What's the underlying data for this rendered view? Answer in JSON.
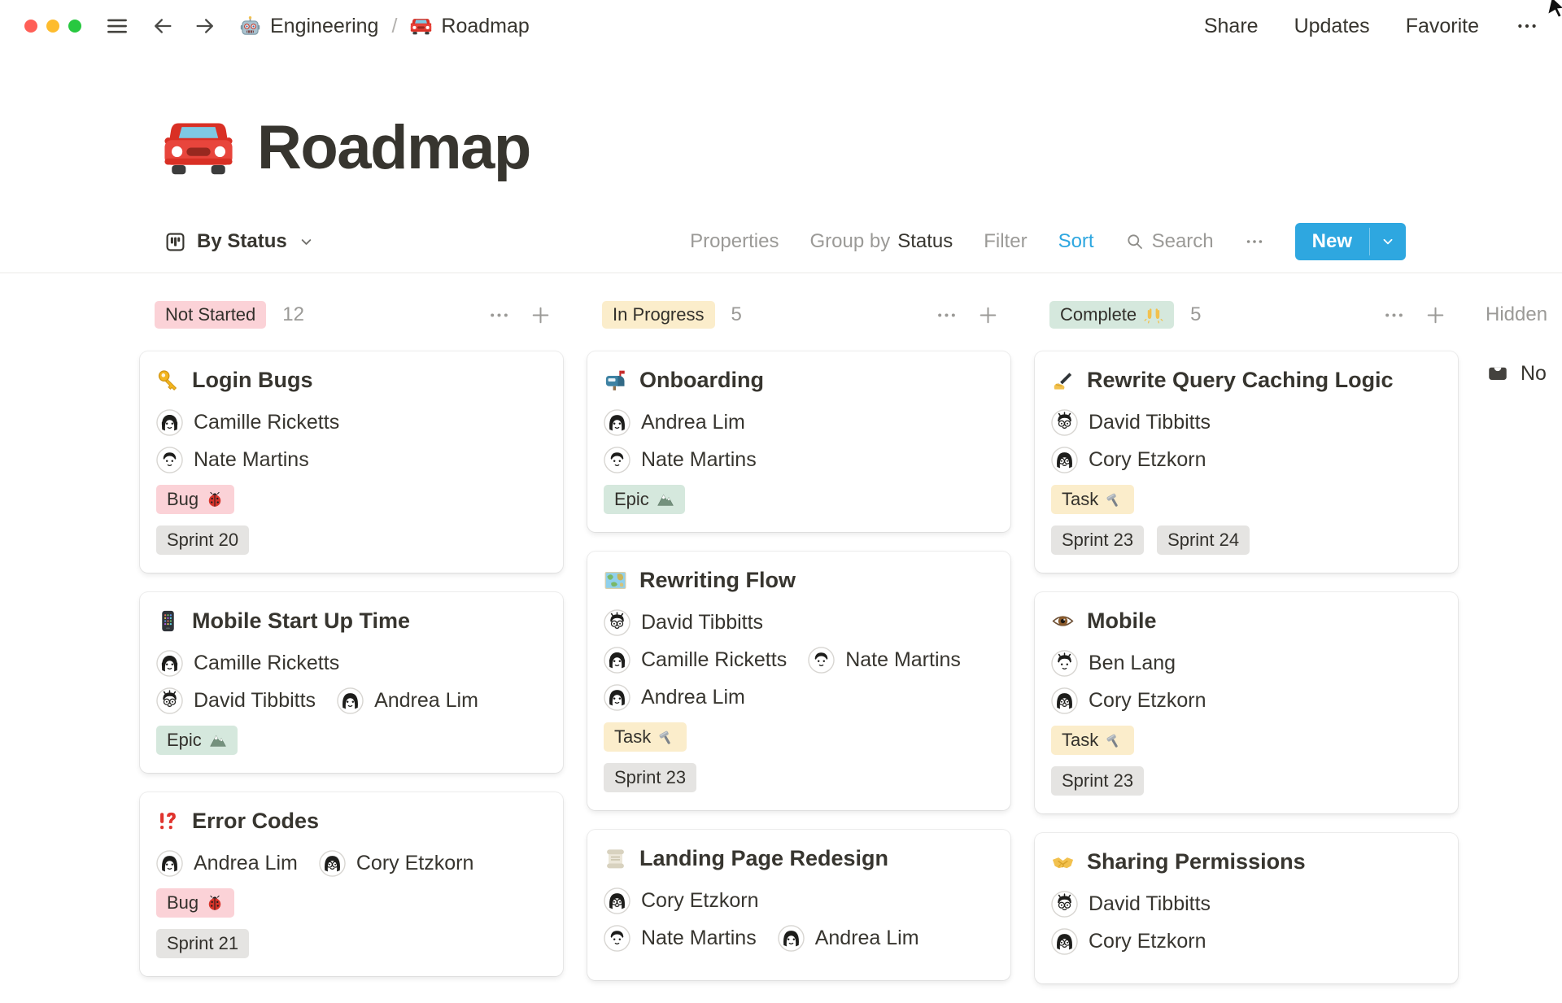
{
  "window": {
    "breadcrumb": [
      {
        "icon": "robot-icon",
        "label": "Engineering"
      },
      {
        "icon": "car-icon",
        "label": "Roadmap"
      }
    ],
    "breadcrumb_separator": "/",
    "actions": [
      "Share",
      "Updates",
      "Favorite"
    ]
  },
  "page": {
    "icon": "car-icon",
    "title": "Roadmap"
  },
  "toolbar": {
    "view_icon": "board-icon",
    "view_label": "By Status",
    "properties_label": "Properties",
    "group_by_prefix": "Group by",
    "group_by_value": "Status",
    "filter_label": "Filter",
    "sort_label": "Sort",
    "search_label": "Search",
    "new_label": "New"
  },
  "people": {
    "camille": {
      "name": "Camille Ricketts",
      "avatar": "woman-headphones"
    },
    "nate": {
      "name": "Nate Martins",
      "avatar": "man"
    },
    "david": {
      "name": "David Tibbitts",
      "avatar": "man-glasses"
    },
    "andrea": {
      "name": "Andrea Lim",
      "avatar": "woman-bob"
    },
    "cory": {
      "name": "Cory Etzkorn",
      "avatar": "woman-glasses"
    },
    "ben": {
      "name": "Ben Lang",
      "avatar": "man-dark"
    }
  },
  "board": {
    "columns": [
      {
        "name": "Not Started",
        "count": "12",
        "color": "pink",
        "cards": [
          {
            "icon": "key-icon",
            "title": "Login Bugs",
            "people": [
              [
                "camille"
              ],
              [
                "nate"
              ]
            ],
            "tags": [
              [
                {
                  "label": "Bug",
                  "icon": "ladybug-icon",
                  "color": "pink"
                }
              ],
              [
                {
                  "label": "Sprint 20",
                  "color": "gray"
                }
              ]
            ]
          },
          {
            "icon": "phone-icon",
            "title": "Mobile Start Up Time",
            "people": [
              [
                "camille"
              ],
              [
                "david",
                "andrea"
              ]
            ],
            "tags": [
              [
                {
                  "label": "Epic",
                  "icon": "mountain-icon",
                  "color": "green"
                }
              ]
            ]
          },
          {
            "icon": "bangbang-icon",
            "title": "Error Codes",
            "people": [
              [
                "andrea",
                "cory"
              ]
            ],
            "tags": [
              [
                {
                  "label": "Bug",
                  "icon": "ladybug-icon",
                  "color": "pink"
                }
              ],
              [
                {
                  "label": "Sprint 21",
                  "color": "gray"
                }
              ]
            ]
          }
        ]
      },
      {
        "name": "In Progress",
        "count": "5",
        "color": "yellow",
        "cards": [
          {
            "icon": "mailbox-icon",
            "title": "Onboarding",
            "people": [
              [
                "andrea"
              ],
              [
                "nate"
              ]
            ],
            "tags": [
              [
                {
                  "label": "Epic",
                  "icon": "mountain-icon",
                  "color": "green"
                }
              ]
            ]
          },
          {
            "icon": "map-icon",
            "title": "Rewriting Flow",
            "people": [
              [
                "david"
              ],
              [
                "camille",
                "nate"
              ],
              [
                "andrea"
              ]
            ],
            "tags": [
              [
                {
                  "label": "Task",
                  "icon": "hammer-icon",
                  "color": "yellow"
                }
              ],
              [
                {
                  "label": "Sprint 23",
                  "color": "gray"
                }
              ]
            ]
          },
          {
            "icon": "scroll-icon",
            "title": "Landing Page Redesign",
            "people": [
              [
                "cory"
              ],
              [
                "nate",
                "andrea"
              ]
            ],
            "tags": []
          }
        ]
      },
      {
        "name": "Complete",
        "icon": "raised-hands-icon",
        "count": "5",
        "color": "green",
        "cards": [
          {
            "icon": "writing-hand-icon",
            "title": "Rewrite Query Caching Logic",
            "people": [
              [
                "david"
              ],
              [
                "cory"
              ]
            ],
            "tags": [
              [
                {
                  "label": "Task",
                  "icon": "hammer-icon",
                  "color": "yellow"
                }
              ],
              [
                {
                  "label": "Sprint 23",
                  "color": "gray"
                },
                {
                  "label": "Sprint 24",
                  "color": "gray"
                }
              ]
            ]
          },
          {
            "icon": "eye-icon",
            "title": "Mobile",
            "people": [
              [
                "ben"
              ],
              [
                "cory"
              ]
            ],
            "tags": [
              [
                {
                  "label": "Task",
                  "icon": "hammer-icon",
                  "color": "yellow"
                }
              ],
              [
                {
                  "label": "Sprint 23",
                  "color": "gray"
                }
              ]
            ]
          },
          {
            "icon": "handshake-icon",
            "title": "Sharing Permissions",
            "people": [
              [
                "david"
              ],
              [
                "cory"
              ]
            ],
            "tags": []
          }
        ]
      }
    ],
    "hidden": {
      "label": "Hidden",
      "item_icon": "inbox-icon",
      "item_label": "No"
    }
  },
  "colors": {
    "accent_blue": "#2EA7E0",
    "text": "#37352F",
    "muted": "#9B9A97",
    "tags": {
      "pink": "#FBD2D7",
      "yellow": "#FBEDCB",
      "green": "#D5E8DD",
      "gray": "#E5E4E2"
    }
  },
  "icons": {
    "robot-icon": "🤖",
    "car-icon": "🚗",
    "board-icon": "kanban-board",
    "chevron-down-icon": "⌄",
    "search-icon": "🔍",
    "more-icon": "•••",
    "plus-icon": "+",
    "menu-icon": "≡",
    "back-icon": "←",
    "forward-icon": "→",
    "key-icon": "🔑",
    "phone-icon": "📱",
    "bangbang-icon": "⁉️",
    "mailbox-icon": "📬",
    "map-icon": "🗺️",
    "scroll-icon": "📜",
    "writing-hand-icon": "✍️",
    "eye-icon": "👁️",
    "handshake-icon": "🤝",
    "ladybug-icon": "🐞",
    "mountain-icon": "🏔️",
    "hammer-icon": "🔨",
    "raised-hands-icon": "🙌",
    "inbox-icon": "📥"
  }
}
